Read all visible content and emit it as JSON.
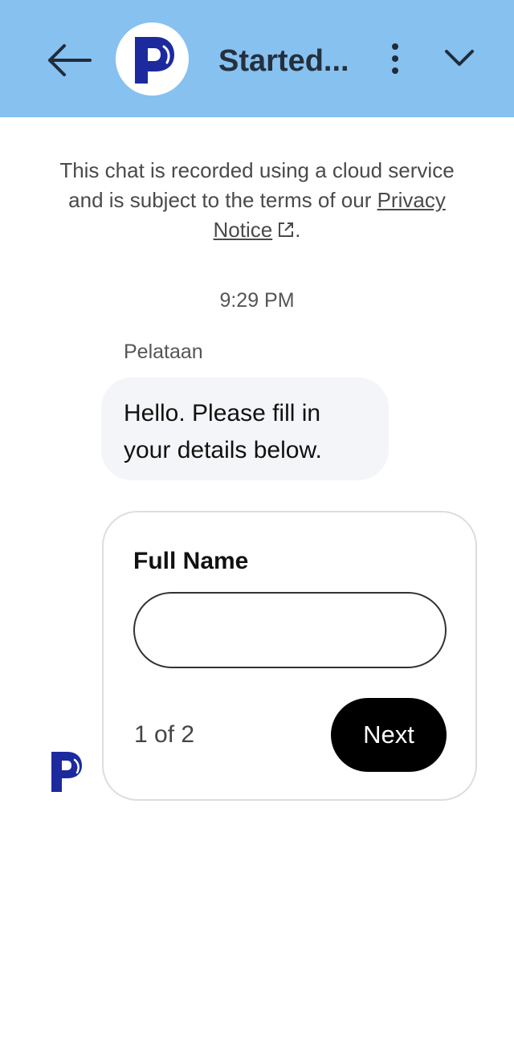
{
  "header": {
    "title": "Started...",
    "icons": {
      "back": "arrow-left-icon",
      "logo": "p-logo",
      "menu": "more-vertical-icon",
      "collapse": "chevron-down-icon"
    }
  },
  "notice": {
    "text_before": "This chat is recorded using a cloud service and is subject to the terms of our ",
    "link_text": "Privacy Notice",
    "text_after": ".",
    "link_icon": "external-link-icon"
  },
  "chat": {
    "timestamp": "9:29 PM",
    "sender": "Pelataan",
    "message": "Hello. Please fill in your details below."
  },
  "form": {
    "label": "Full Name",
    "input_value": "",
    "pager": "1 of 2",
    "next_label": "Next"
  },
  "colors": {
    "header_bg": "#87c1f0",
    "logo_blue": "#1c2a9e",
    "bubble_bg": "#f3f5f8",
    "button_bg": "#000000"
  }
}
